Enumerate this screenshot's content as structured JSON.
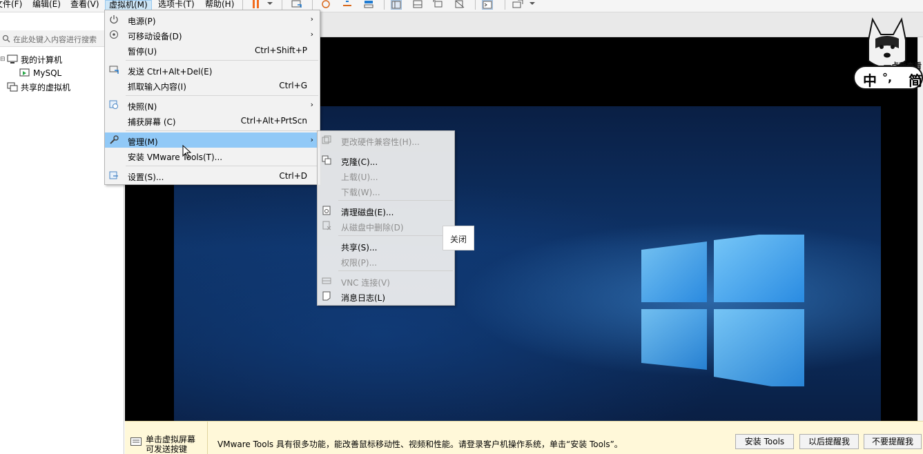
{
  "menubar": {
    "items": [
      "文件(F)",
      "编辑(E)",
      "查看(V)",
      "虚拟机(M)",
      "选项卡(T)",
      "帮助(H)"
    ],
    "active_index": 3
  },
  "toolbar": {
    "icons": [
      "pause-icon",
      "dropdown-arrow-icon",
      "send-keys-icon",
      "snapshot-icon",
      "revert-snapshot-icon",
      "manage-snapshots-icon",
      "library-view-icon",
      "thumbnail-view-icon",
      "fullscreen-icon",
      "unity-icon",
      "console-icon",
      "stretch-icon",
      "dropdown-arrow-icon"
    ],
    "pause_color": "#f26b1d"
  },
  "library": {
    "search_placeholder": "在此处键入内容进行搜索",
    "tree": [
      {
        "label": "我的计算机",
        "icon": "computer-icon"
      },
      {
        "label": "MySQL",
        "icon": "vm-icon"
      },
      {
        "label": "共享的虚拟机",
        "icon": "shared-vm-icon"
      }
    ]
  },
  "vm_menu": {
    "items": [
      {
        "label": "电源(P)",
        "shortcut": "",
        "submenu": true,
        "icon": "power-icon"
      },
      {
        "label": "可移动设备(D)",
        "shortcut": "",
        "submenu": true,
        "icon": "removable-device-icon"
      },
      {
        "label": "暂停(U)",
        "shortcut": "Ctrl+Shift+P",
        "submenu": false,
        "icon": ""
      },
      {
        "label": "发送 Ctrl+Alt+Del(E)",
        "shortcut": "",
        "submenu": false,
        "icon": "send-keys-icon"
      },
      {
        "label": "抓取输入内容(I)",
        "shortcut": "Ctrl+G",
        "submenu": false,
        "icon": ""
      },
      {
        "label": "快照(N)",
        "shortcut": "",
        "submenu": true,
        "icon": "snapshot-icon"
      },
      {
        "label": "捕获屏幕 (C)",
        "shortcut": "Ctrl+Alt+PrtScn",
        "submenu": false,
        "icon": ""
      },
      {
        "label": "管理(M)",
        "shortcut": "",
        "submenu": true,
        "icon": "wrench-icon",
        "highlighted": true
      },
      {
        "label": "安装 VMware Tools(T)...",
        "shortcut": "",
        "submenu": false,
        "icon": ""
      },
      {
        "label": "设置(S)...",
        "shortcut": "Ctrl+D",
        "submenu": false,
        "icon": "settings-icon"
      }
    ],
    "highlight_color": "#91c9f7"
  },
  "manage_submenu": {
    "items": [
      {
        "label": "更改硬件兼容性(H)...",
        "enabled": false,
        "icon": "hardware-compat-icon"
      },
      {
        "label": "克隆(C)...",
        "enabled": true,
        "icon": "clone-icon"
      },
      {
        "label": "上载(U)...",
        "enabled": false,
        "icon": ""
      },
      {
        "label": "下载(W)...",
        "enabled": false,
        "icon": ""
      },
      {
        "label": "清理磁盘(E)...",
        "enabled": true,
        "icon": "clean-disk-icon"
      },
      {
        "label": "从磁盘中删除(D)",
        "enabled": false,
        "icon": "delete-disk-icon"
      },
      {
        "label": "共享(S)...",
        "enabled": true,
        "icon": ""
      },
      {
        "label": "权限(P)...",
        "enabled": false,
        "icon": ""
      },
      {
        "label": "VNC 连接(V)",
        "enabled": false,
        "icon": "vnc-icon"
      },
      {
        "label": "消息日志(L)",
        "enabled": true,
        "icon": "message-log-icon"
      }
    ]
  },
  "close_tooltip": "关闭",
  "mascot": {
    "tip": "一点我查看",
    "ime_left": "中",
    "ime_mid": "°,",
    "ime_right": "简"
  },
  "notification": {
    "left_line1": "单击虚拟屏幕",
    "left_line2": "可发送按键",
    "message": "VMware Tools 具有很多功能，能改善鼠标移动性、视频和性能。请登录客户机操作系统，单击“安装 Tools”。",
    "buttons": [
      "安装 Tools",
      "以后提醒我",
      "不要提醒我"
    ]
  },
  "colors": {
    "menu_bg": "#f2f2f2",
    "notification_bg": "#fff8d9",
    "desktop_blue": "#0e3368"
  }
}
